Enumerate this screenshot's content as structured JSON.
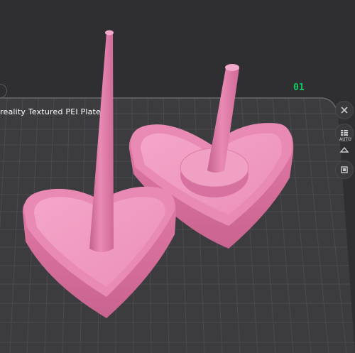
{
  "viewport": {
    "plate_name": "Creality Textured PEI Plate",
    "plate_label_visible": "reality Textured PEI Plate",
    "plate_number": "01"
  },
  "side_toolbar": {
    "auto_label": "AUTO",
    "icons": [
      "close-icon",
      "list-icon",
      "auto-orient-icon",
      "arrange-icon"
    ]
  },
  "colors": {
    "background": "#2f2f31",
    "plate": "#3c3c3e",
    "grid_line": "#4d4d50",
    "model": "#e886b0",
    "plate_number": "#17c964"
  }
}
